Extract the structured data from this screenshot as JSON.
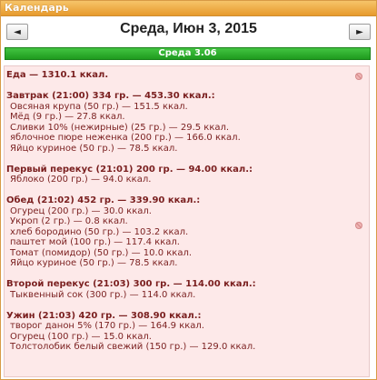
{
  "window": {
    "title": "Календарь"
  },
  "nav": {
    "prev_icon": "◄",
    "next_icon": "►",
    "date": "Среда, Июн 3, 2015"
  },
  "day_header": "Среда 3.06",
  "total": "Еда — 1310.1 ккал.",
  "meals": [
    {
      "header": "Завтрак (21:00) 334 гр. — 453.30 ккал.:",
      "items": [
        "Овсяная крупа (50 гр.) — 151.5 ккал.",
        "Мёд (9 гр.) — 27.8 ккал.",
        "Сливки 10% (нежирные) (25 гр.) — 29.5 ккал.",
        "яблочное пюре неженка (200 гр.) — 166.0 ккал.",
        "Яйцо куриное (50 гр.) — 78.5 ккал."
      ]
    },
    {
      "header": "Первый перекус (21:01) 200 гр. — 94.00 ккал.:",
      "items": [
        "Яблоко (200 гр.) — 94.0 ккал."
      ]
    },
    {
      "header": "Обед (21:02) 452 гр. — 339.90 ккал.:",
      "items": [
        "Огурец (200 гр.) — 30.0 ккал.",
        "Укроп (2 гр.) — 0.8 ккал.",
        "хлеб бородино (50 гр.) — 103.2 ккал.",
        "паштет мой (100 гр.) — 117.4 ккал.",
        "Томат (помидор) (50 гр.) — 10.0 ккал.",
        "Яйцо куриное (50 гр.) — 78.5 ккал."
      ]
    },
    {
      "header": "Второй перекус (21:03) 300 гр. — 114.00 ккал.:",
      "items": [
        "Тыквенный сок (300 гр.) — 114.0 ккал."
      ]
    },
    {
      "header": "Ужин (21:03) 420 гр. — 308.90 ккал.:",
      "items": [
        "творог данон 5% (170 гр.) — 164.9 ккал.",
        "Огурец (100 гр.) — 15.0 ккал.",
        "Толстолобик белый свежий (150 гр.) — 129.0 ккал."
      ]
    }
  ],
  "icons": {
    "pin": "pin-icon"
  },
  "colors": {
    "title_bar": "#e79a2c",
    "day_header": "#1f9b1e",
    "content_bg": "#fde9e9",
    "text": "#7a1f1f"
  }
}
